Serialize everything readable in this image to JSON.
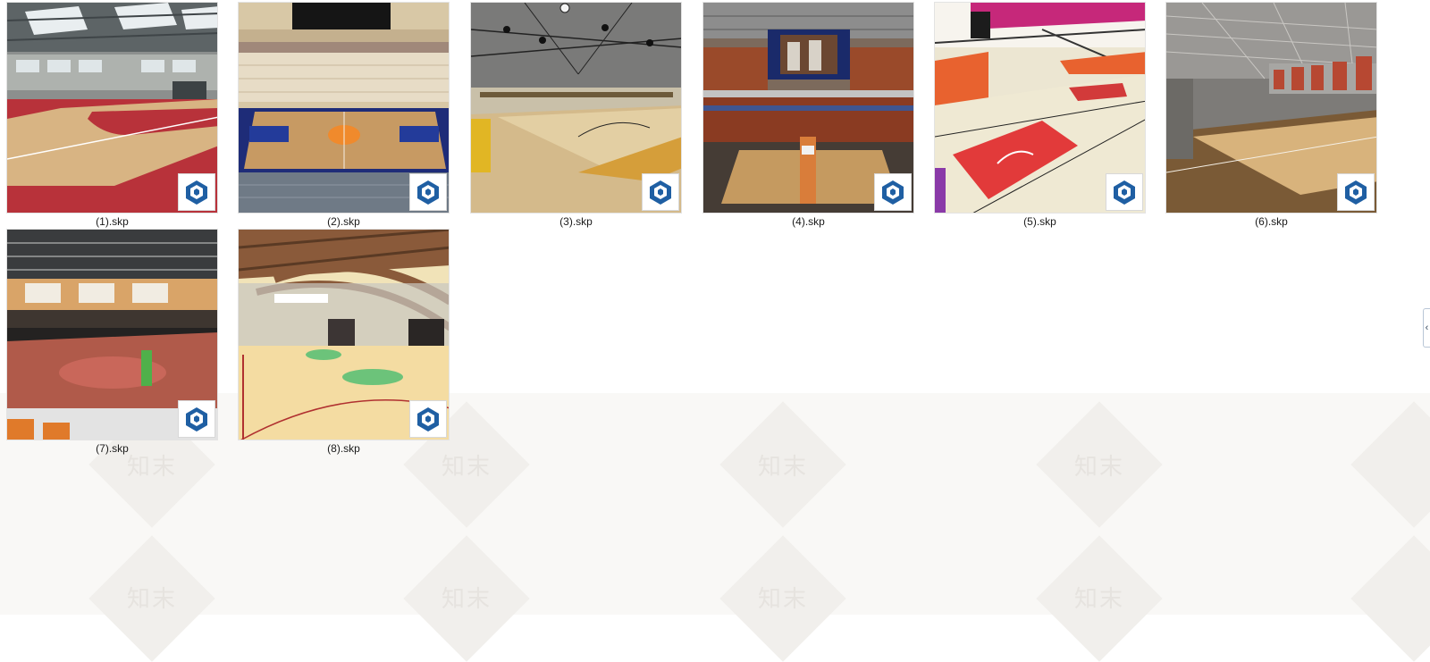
{
  "watermark": {
    "text": "知末"
  },
  "files": [
    {
      "name": "(1).skp",
      "thumb": "sports-hall-red-court",
      "badge_icon": "sketchup-logo-icon"
    },
    {
      "name": "(2).skp",
      "thumb": "arena-knicks-court",
      "badge_icon": "sketchup-logo-icon"
    },
    {
      "name": "(3).skp",
      "thumb": "gym-pendant-lights",
      "badge_icon": "sketchup-logo-icon"
    },
    {
      "name": "(4).skp",
      "thumb": "illinois-arena-scoreboard",
      "badge_icon": "sketchup-logo-icon"
    },
    {
      "name": "(5).skp",
      "thumb": "gym-red-paint-lines",
      "badge_icon": "sketchup-logo-icon"
    },
    {
      "name": "(6).skp",
      "thumb": "grey-hall-wood-floor",
      "badge_icon": "sketchup-logo-icon"
    },
    {
      "name": "(7).skp",
      "thumb": "stadium-orange-seats",
      "badge_icon": "sketchup-logo-icon"
    },
    {
      "name": "(8).skp",
      "thumb": "timber-roof-hall",
      "badge_icon": "sketchup-logo-icon"
    }
  ],
  "side_handle": {
    "icon": "chevron-left-icon",
    "glyph": "‹"
  },
  "colors": {
    "sketchup_blue": "#1f5fa3",
    "label": "#1a1a1a"
  }
}
